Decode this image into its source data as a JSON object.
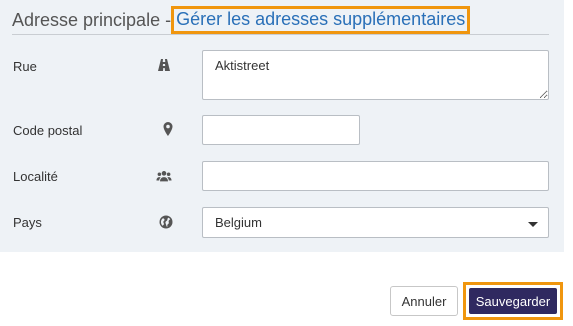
{
  "header": {
    "title": "Adresse principale - ",
    "manage_link": "Gérer les adresses supplémentaires"
  },
  "fields": {
    "street": {
      "label": "Rue",
      "value": "Aktistreet",
      "icon": "road-icon"
    },
    "postal_code": {
      "label": "Code postal",
      "value": "",
      "icon": "map-marker-icon"
    },
    "locality": {
      "label": "Localité",
      "value": "",
      "icon": "users-icon"
    },
    "country": {
      "label": "Pays",
      "selected": "Belgium",
      "icon": "globe-icon"
    }
  },
  "buttons": {
    "cancel": "Annuler",
    "save": "Sauvegarder"
  },
  "colors": {
    "panel_bg": "#eef2f6",
    "link": "#2a70b8",
    "highlight": "#f0960e",
    "save_bg": "#2f2960"
  }
}
